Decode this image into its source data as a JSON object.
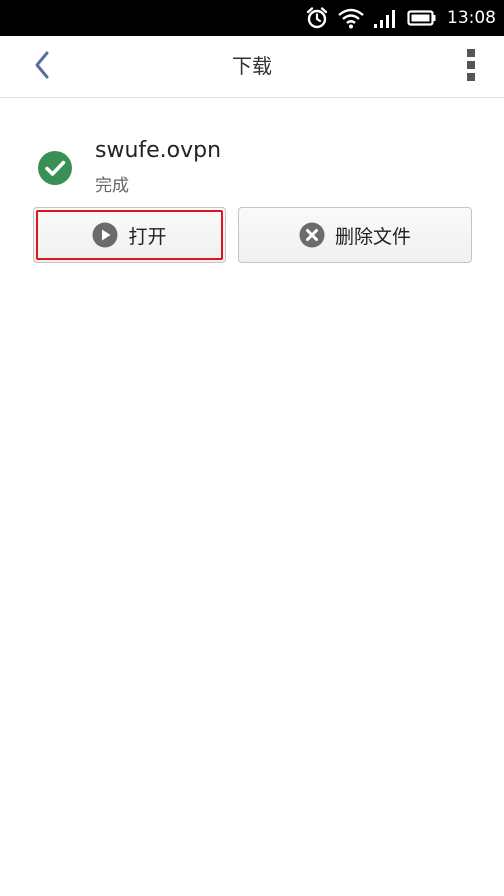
{
  "status_bar": {
    "time": "13:08",
    "icons": [
      "alarm-icon",
      "wifi-icon",
      "signal-icon",
      "battery-icon"
    ]
  },
  "header": {
    "title": "下载",
    "back_icon": "chevron-left-icon",
    "menu_icon": "more-vert-icon"
  },
  "download": {
    "file_name": "swufe.ovpn",
    "status": "完成",
    "status_icon": "check-circle-icon"
  },
  "actions": {
    "open_label": "打开",
    "open_icon": "play-icon",
    "delete_label": "删除文件",
    "delete_icon": "close-circle-icon"
  },
  "colors": {
    "accent_check": "#3a8f55",
    "highlight": "#e0141e",
    "back_icon": "#5a6fa0",
    "icon_gray": "#6b6b6b"
  }
}
